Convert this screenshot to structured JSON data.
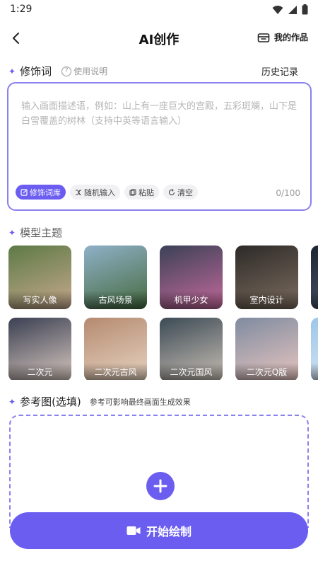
{
  "status_bar": {
    "time": "1:29"
  },
  "header": {
    "title": "AI创作",
    "my_works_label": "我的作品"
  },
  "modifier_section": {
    "title": "修饰词",
    "help_label": "使用说明",
    "history_label": "历史记录",
    "input_placeholder": "输入画面描述语，例如：山上有一座巨大的宫殿，五彩斑斓，山下是白雪覆盖的树林（支持中英等语言输入）",
    "input_value": "",
    "counter": "0/100",
    "chips": [
      {
        "label": "修饰词库",
        "icon": "edit-icon",
        "active": true
      },
      {
        "label": "随机输入",
        "icon": "shuffle-icon",
        "active": false
      },
      {
        "label": "粘贴",
        "icon": "paste-icon",
        "active": false
      },
      {
        "label": "清空",
        "icon": "refresh-icon",
        "active": false
      }
    ]
  },
  "theme_section": {
    "title": "模型主题",
    "themes": [
      {
        "label": "写实人像",
        "colors": [
          "#5d7a45",
          "#c7a98e"
        ]
      },
      {
        "label": "古风场景",
        "colors": [
          "#8fb0c8",
          "#456b3e"
        ]
      },
      {
        "label": "机甲少女",
        "colors": [
          "#3b4157",
          "#c46a9c"
        ]
      },
      {
        "label": "室内设计",
        "colors": [
          "#2d2a28",
          "#7d6d5f"
        ]
      },
      {
        "label": "",
        "colors": [
          "#1e2433",
          "#4e5a70"
        ]
      },
      {
        "label": "二次元",
        "colors": [
          "#3a3f52",
          "#d9c9c0"
        ]
      },
      {
        "label": "二次元古风",
        "colors": [
          "#b58a70",
          "#e7d4c1"
        ]
      },
      {
        "label": "二次元国风",
        "colors": [
          "#3c4a55",
          "#c9c0b5"
        ]
      },
      {
        "label": "二次元Q版",
        "colors": [
          "#7f8ba0",
          "#e8c6c0"
        ]
      },
      {
        "label": "",
        "colors": [
          "#9cc6e8",
          "#dfeaf5"
        ]
      }
    ]
  },
  "reference_section": {
    "title": "参考图(选填)",
    "note": "参考可影响最终画面生成效果"
  },
  "start_button": {
    "label": "开始绘制",
    "icon": "video-icon"
  },
  "colors": {
    "accent": "#6a5df0",
    "border": "#8a80ee"
  }
}
